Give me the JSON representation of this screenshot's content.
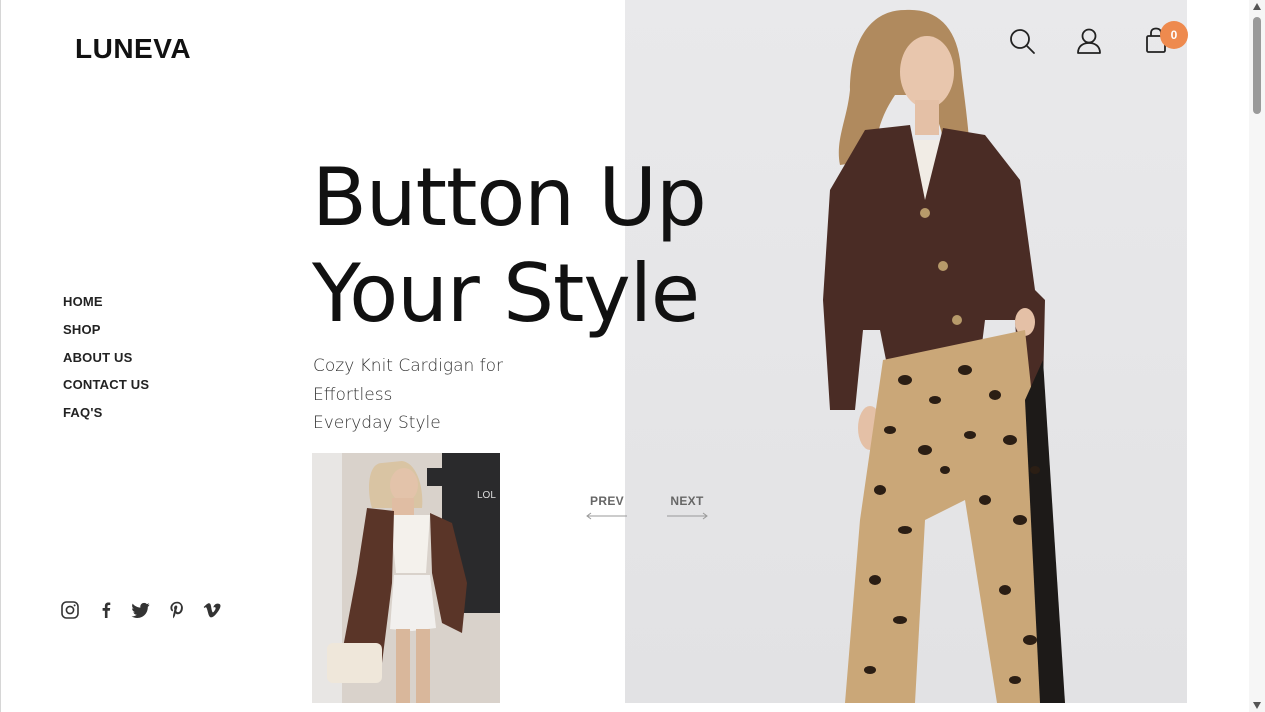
{
  "brand": {
    "logo": "LUNEVA"
  },
  "header": {
    "icons": [
      "search-icon",
      "user-icon",
      "cart-icon"
    ],
    "cart_count": "0",
    "badge_color": "#ee8a4e"
  },
  "nav": {
    "items": [
      {
        "label": "HOME"
      },
      {
        "label": "SHOP"
      },
      {
        "label": "ABOUT US"
      },
      {
        "label": "CONTACT US"
      },
      {
        "label": "FAQ'S"
      }
    ]
  },
  "hero": {
    "headline_line1": "Button Up",
    "headline_line2": "Your Style",
    "subtitle_line1": "Cozy Knit Cardigan for",
    "subtitle_line2": "Effortless",
    "subtitle_line3": "Everyday Style"
  },
  "slider": {
    "prev_label": "PREV",
    "next_label": "NEXT"
  },
  "social": {
    "icons": [
      "instagram-icon",
      "facebook-icon",
      "twitter-icon",
      "pinterest-icon",
      "vimeo-icon"
    ]
  },
  "colors": {
    "text": "#111111",
    "hero_bg": "#e7e7e8",
    "cardigan": "#4a2c25"
  }
}
